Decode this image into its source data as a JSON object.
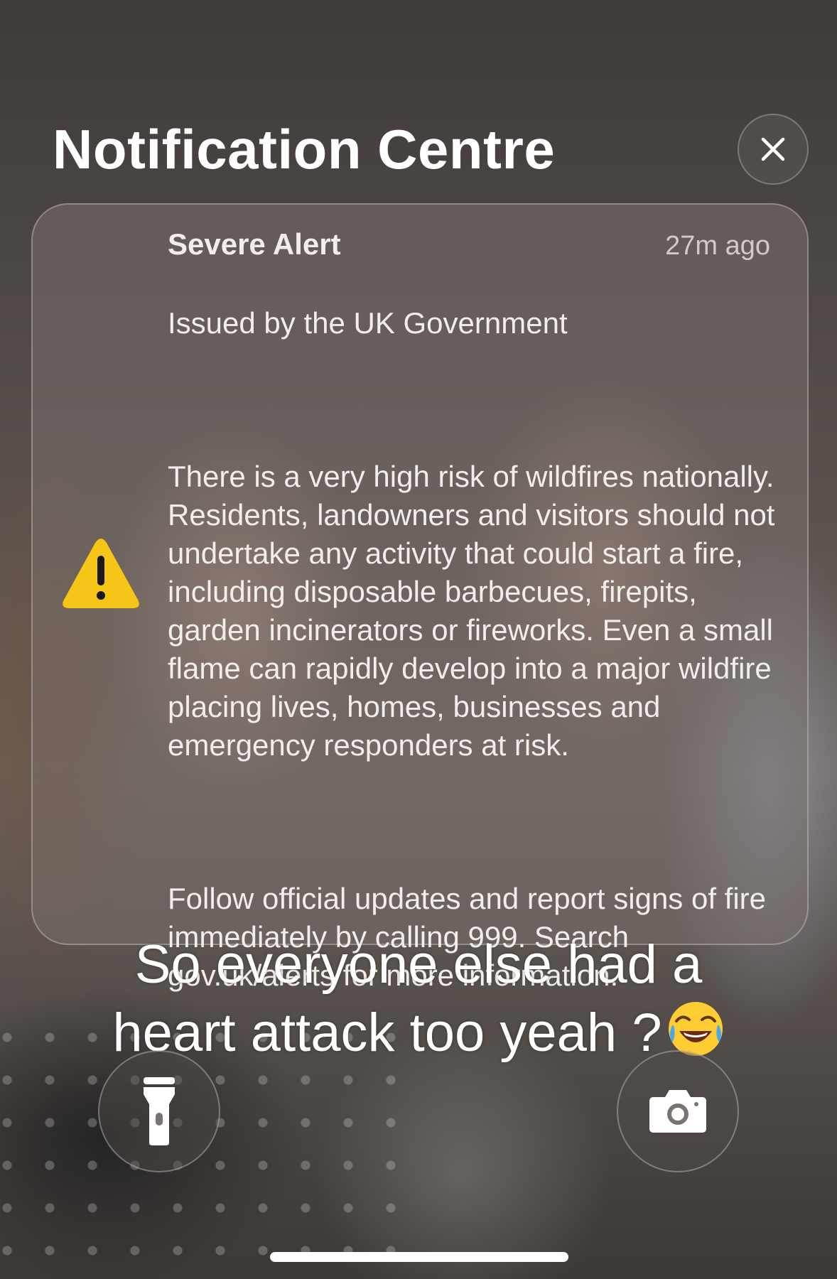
{
  "header": {
    "title": "Notification Centre"
  },
  "notification": {
    "title": "Severe Alert",
    "time": "27m ago",
    "issuer": "Issued by the UK Government",
    "paragraph1": "There is a very high risk of wildfires nationally. Residents, landowners and visitors should not undertake any activity that could start a fire, including disposable barbecues, firepits, garden incinerators or fireworks. Even a small flame can rapidly develop into a major wildfire placing lives, homes, businesses and emergency responders at risk.",
    "paragraph2": "Follow official updates and report signs of fire immediately by calling 999. Search gov.uk/alerts for more information.",
    "icon": "warning-icon",
    "icon_color": "#F5C518"
  },
  "caption": {
    "line1": "So everyone else had a",
    "line2": "heart attack too yeah ?",
    "emoji": "face-with-tears-of-joy"
  },
  "controls": {
    "left_icon": "flashlight-icon",
    "right_icon": "camera-icon",
    "close_icon": "close-icon"
  }
}
